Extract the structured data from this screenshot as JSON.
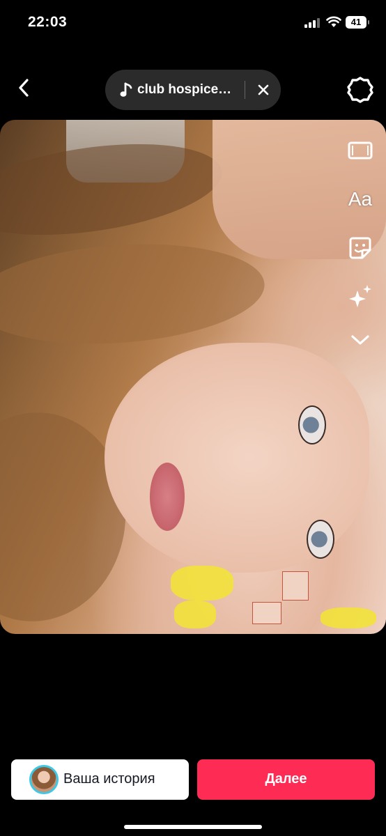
{
  "status_bar": {
    "time": "22:03",
    "battery": "41"
  },
  "top_bar": {
    "sound_title": "club hospice…"
  },
  "tools": {
    "text_label": "Aa"
  },
  "bottom": {
    "story_label": "Ваша история",
    "next_label": "Далее"
  },
  "colors": {
    "accent": "#fe2c55",
    "avatar_ring": "#3dc8e6",
    "background": "#000000",
    "pill": "#2b2b2b"
  },
  "icons": [
    "back-chevron-icon",
    "music-note-icon",
    "close-icon",
    "gear-icon",
    "crop-icon",
    "text-icon",
    "sticker-icon",
    "effects-sparkle-icon",
    "chevron-down-icon"
  ]
}
